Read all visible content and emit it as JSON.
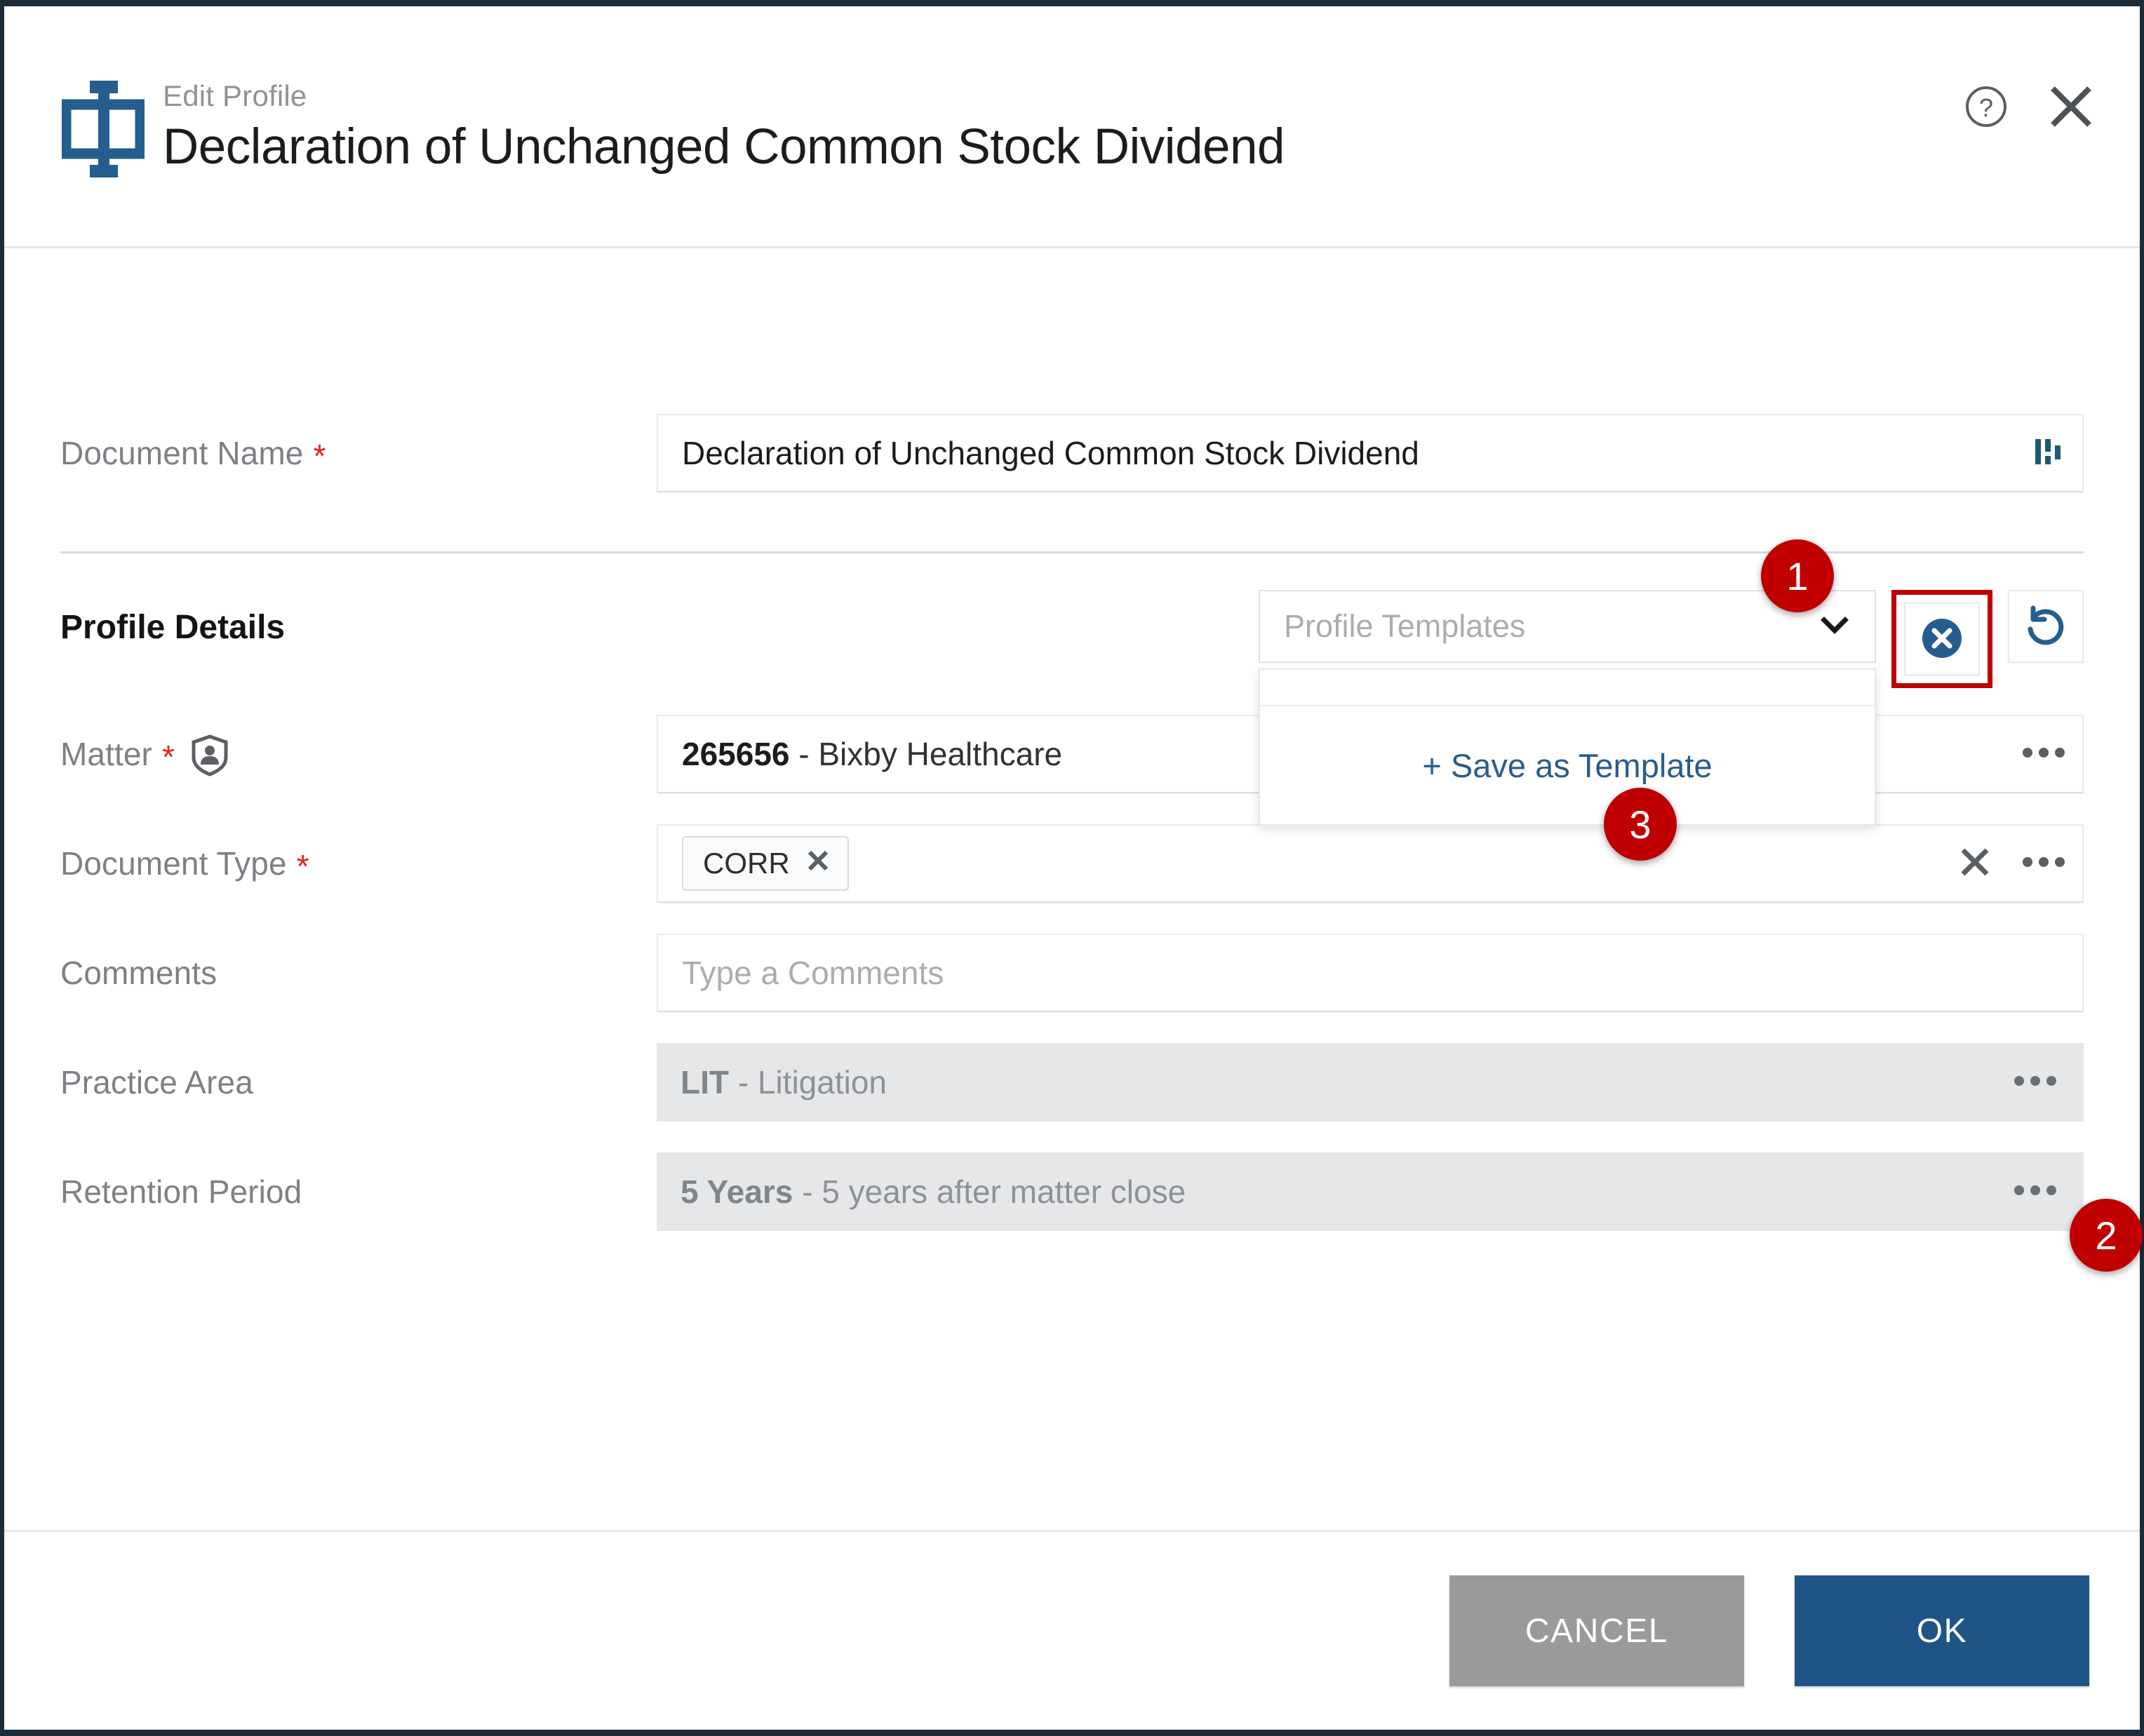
{
  "header": {
    "eyebrow": "Edit Profile",
    "title": "Declaration of Unchanged Common Stock Dividend",
    "logo_icon": "document-beam-logo-icon",
    "help_icon": "help-circle-icon",
    "close_icon": "close-icon"
  },
  "fields": {
    "document_name": {
      "label": "Document Name",
      "required_marker": "*",
      "value": "Declaration of Unchanged Common Stock Dividend",
      "trailing_icon": "bar-chart-icon"
    },
    "matter": {
      "label": "Matter",
      "required_marker": "*",
      "label_icon": "shield-person-icon",
      "value_code": "265656",
      "value_rest": " - Bixby Healthcare",
      "overflow_icon": "more-options-icon"
    },
    "document_type": {
      "label": "Document Type",
      "required_marker": "*",
      "chip_label": "CORR",
      "chip_remove_icon": "chip-remove-icon",
      "clear_icon": "clear-icon",
      "overflow_icon": "more-options-icon"
    },
    "comments": {
      "label": "Comments",
      "placeholder": "Type a Comments"
    },
    "practice_area": {
      "label": "Practice Area",
      "value_code": "LIT",
      "value_rest": " - Litigation",
      "overflow_icon": "more-options-icon"
    },
    "retention_period": {
      "label": "Retention Period",
      "value_code": "5 Years",
      "value_rest": " - 5 years after matter close",
      "overflow_icon": "more-options-icon"
    }
  },
  "profile_details": {
    "heading": "Profile Details",
    "template_select_placeholder": "Profile Templates",
    "chevron_icon": "chevron-down-icon",
    "clear_template_icon": "clear-circle-icon",
    "reset_template_icon": "reset-undo-icon",
    "menu": {
      "save_as_template_label": "+ Save as Template"
    }
  },
  "annotations": {
    "badge_1": "1",
    "badge_2": "2",
    "badge_3": "3",
    "highlight_color": "#c00000"
  },
  "footer": {
    "cancel_label": "CANCEL",
    "ok_label": "OK"
  },
  "colors": {
    "brand_blue": "#1f5586",
    "accent_red": "#c00000",
    "required_red": "#e02020",
    "muted_text": "#7d8185",
    "readonly_bg": "#e6e7e8"
  }
}
